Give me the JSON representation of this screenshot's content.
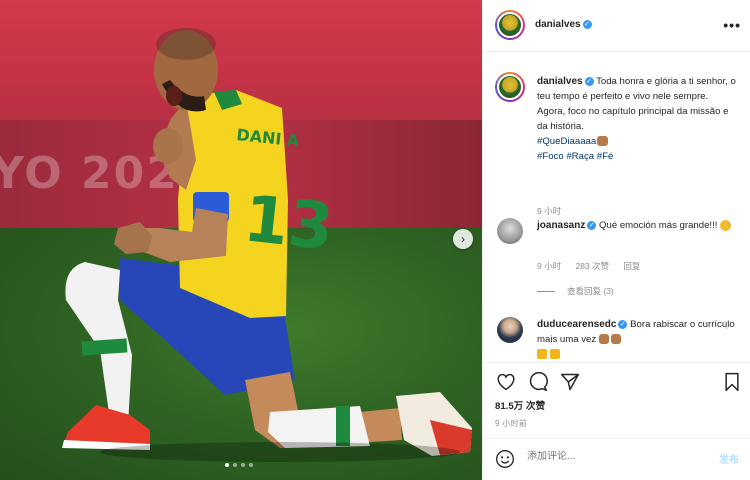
{
  "photo": {
    "backdrop_text": "YO 2020",
    "jersey_name": "DANI A",
    "jersey_number": "13",
    "carousel": {
      "slides": 4,
      "active": 0
    }
  },
  "post": {
    "author": "danialves",
    "more_label": "•••"
  },
  "caption": {
    "user": "danialves",
    "text": "Toda honra e glória a ti senhor, o teu tempo é perfeito e vivo nele sempre.",
    "text2": "Agora, foco no capítulo principal da missão e da história.",
    "hashtag1": "#QueDiaaaaa",
    "hashtag2": "#Foco",
    "hashtag3": "#Raça",
    "hashtag4": "#Fé",
    "time": "9 小时"
  },
  "comments": [
    {
      "user": "joanasanz",
      "text": "Qué emoción más grande!!!",
      "time": "9 小时",
      "likes": "283 次赞",
      "reply": "回复",
      "view_replies": "查看回复 (3)"
    },
    {
      "user": "duducearensedc",
      "text": "Bora rabiscar o currículo mais uma vez"
    }
  ],
  "actions": {
    "likes": "81.5万 次赞",
    "time": "9 小时前"
  },
  "add_comment": {
    "placeholder": "添加评论...",
    "post_label": "发布"
  },
  "colors": {
    "link": "#00376b",
    "verified": "#3897f0",
    "muted": "#8e8e8e",
    "post_disabled": "#b2dffc"
  }
}
